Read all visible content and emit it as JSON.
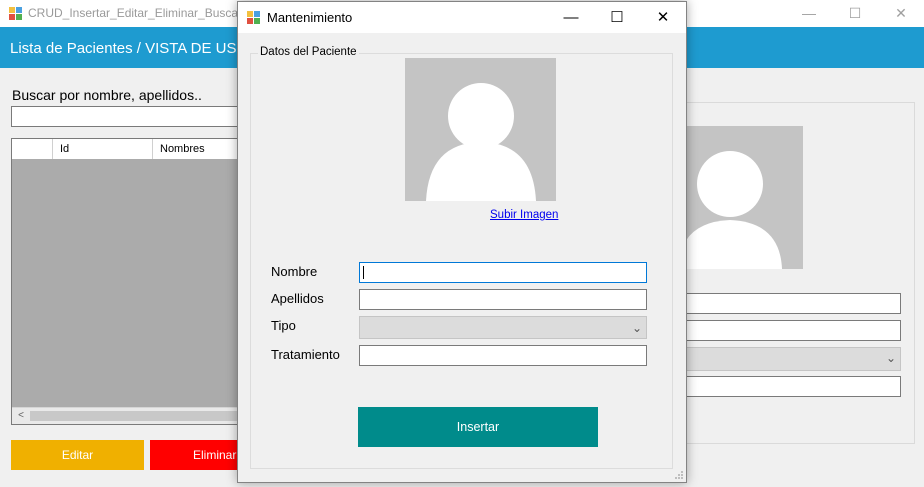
{
  "background_window": {
    "title": "CRUD_Insertar_Editar_Eliminar_Buscar C",
    "header_title": "Lista de Pacientes / VISTA DE USU",
    "search_label": "Buscar por nombre, apellidos..",
    "search_value": "",
    "grid_columns": [
      "Id",
      "Nombres"
    ],
    "edit_button": "Editar",
    "delete_button": "Eliminar",
    "controls": {
      "minimize": "—",
      "maximize": "☐",
      "close": "✕"
    },
    "scroll_left": "<",
    "colors": {
      "header": "#1e9bd0",
      "edit": "#f0b000",
      "delete": "#ff0000"
    }
  },
  "dialog": {
    "title": "Mantenimiento",
    "controls": {
      "minimize": "—",
      "maximize": "☐",
      "close": "✕"
    },
    "group_title": "Datos del Paciente",
    "upload_link": "Subir Imagen",
    "fields": {
      "nombre": {
        "label": "Nombre",
        "value": ""
      },
      "apellidos": {
        "label": "Apellidos",
        "value": ""
      },
      "tipo": {
        "label": "Tipo",
        "value": ""
      },
      "tratamiento": {
        "label": "Tratamiento",
        "value": ""
      }
    },
    "dropdown_arrow": "⌄",
    "submit_button": "Insertar",
    "colors": {
      "submit": "#008b8b",
      "focus": "#0078d7"
    }
  }
}
